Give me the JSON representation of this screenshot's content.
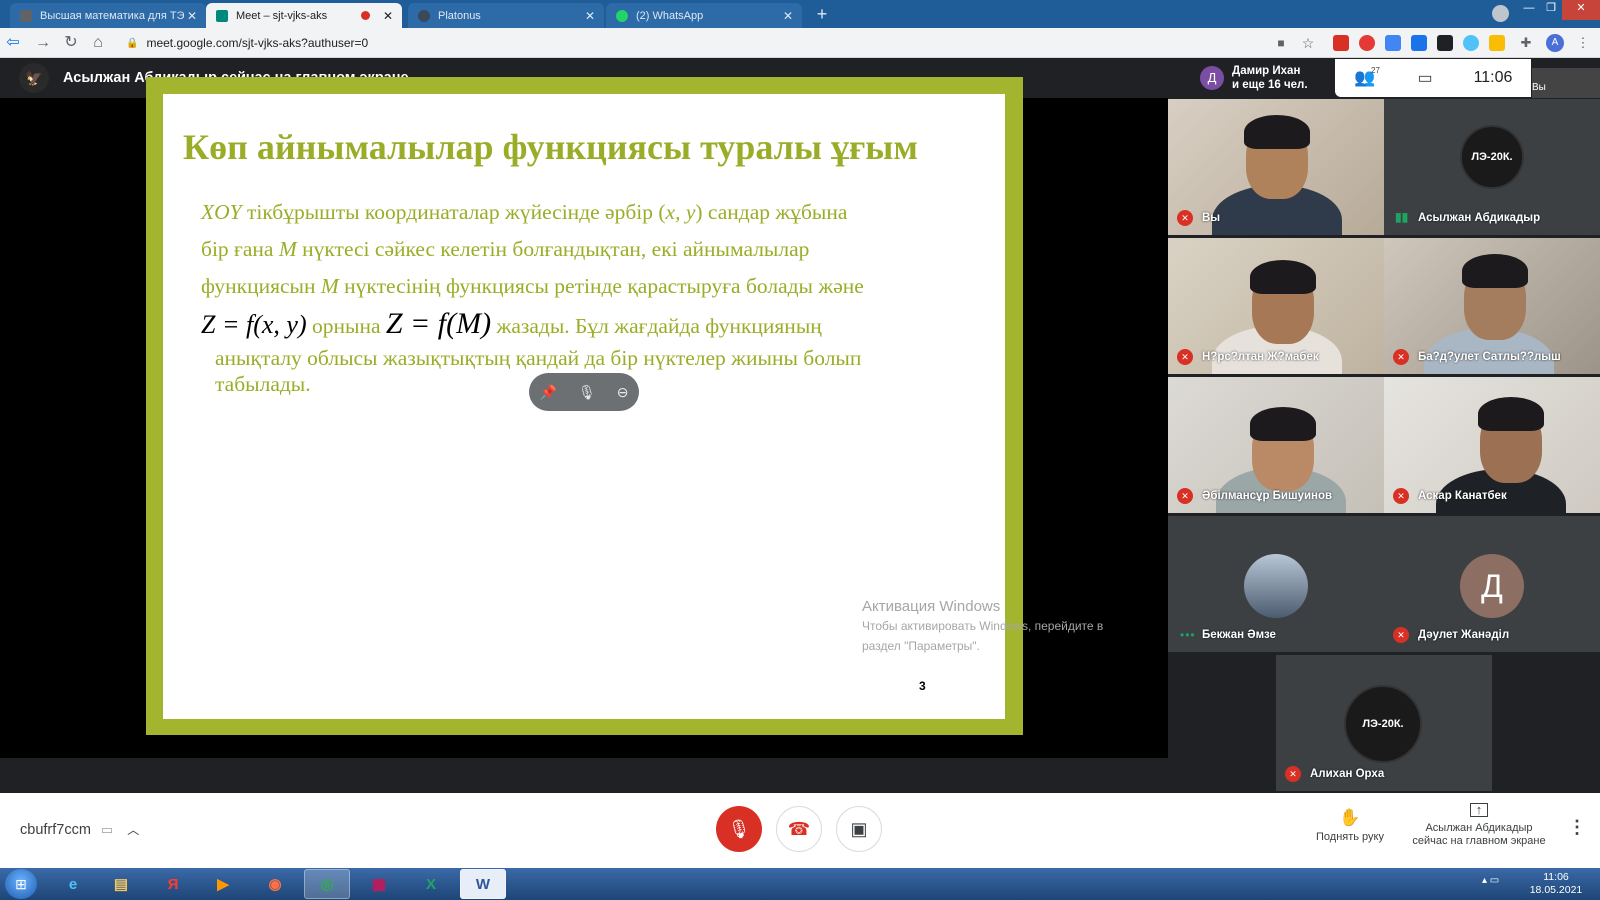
{
  "browser": {
    "tabs": [
      {
        "label": "Высшая математика для ТЭ",
        "close": "✕"
      },
      {
        "label": "Meet – sjt-vjks-aks",
        "close": "✕"
      },
      {
        "label": "Platonus",
        "close": "✕"
      },
      {
        "label": "(2) WhatsApp",
        "close": "✕"
      }
    ],
    "new_tab": "+",
    "url": "meet.google.com/sjt-vjks-aks?authuser=0",
    "profile_initial": "A"
  },
  "meet": {
    "presenter_banner": "Асылжан Абдикадыр сейчас на главном экране",
    "participants_summary": {
      "initial": "Д",
      "line1": "Дамир Ихан",
      "line2": "и еще 16 чел."
    },
    "people_count": "27",
    "time": "11:06",
    "self_label": "Вы",
    "slide": {
      "title": "Көп айнымалылар функциясы туралы ұғым",
      "line1_pre": "XOY",
      "line1_mid": " тікбұрышты координаталар жүйесінде әрбір (",
      "line1_xy": "x, y",
      "line1_post": ") сандар жұбына",
      "line2_pre": "бір ғана ",
      "line2_m": "M",
      "line2_post": " нүктесі сәйкес келетін болғандықтан, екі айнымалылар",
      "line3_pre": "функциясын ",
      "line3_m": "M",
      "line3_post": " нүктесінің функциясы ретінде қарастыруға болады   және",
      "formula1": "Z = f(x, y)",
      "line4_mid": " орнына ",
      "formula2": "Z = f(M)",
      "line4_post": " жазады. Бұл жағдайда функцияның",
      "line5": "анықталу облысы жазықтықтың қандай да бір  нүктелер жиыны болып",
      "line6": "табылады.",
      "page_number": "3"
    },
    "activation": {
      "title": "Активация Windows",
      "sub1": "Чтобы активировать Windows, перейдите в",
      "sub2": "раздел \"Параметры\"."
    },
    "participants": [
      {
        "name": "Вы"
      },
      {
        "name": "Асылжан Абдикадыр",
        "logo": "ЛЭ-20К."
      },
      {
        "name": "Н?рс?лтан Ж?мабек"
      },
      {
        "name": "Ба?д?улет Сатлы??лыш"
      },
      {
        "name": "Әбілмансұр Бишуинов"
      },
      {
        "name": "Аскар Канатбек"
      },
      {
        "name": "Бекжан Әмзе"
      },
      {
        "name": "Дәулет Жанәділ",
        "initial": "Д"
      },
      {
        "name": "Алихан Орха",
        "logo": "ЛЭ-20К."
      }
    ]
  },
  "bottom": {
    "meeting_code": "cbufrf7ccm",
    "raise_hand": "Поднять руку",
    "present_line1": "Асылжан Абдикадыр",
    "present_line2": "сейчас на главном экране"
  },
  "taskbar": {
    "time": "11:06",
    "date": "18.05.2021"
  },
  "colors": {
    "slide_green": "#9bad28",
    "mute_red": "#d93025",
    "meet_bg": "#202124"
  }
}
